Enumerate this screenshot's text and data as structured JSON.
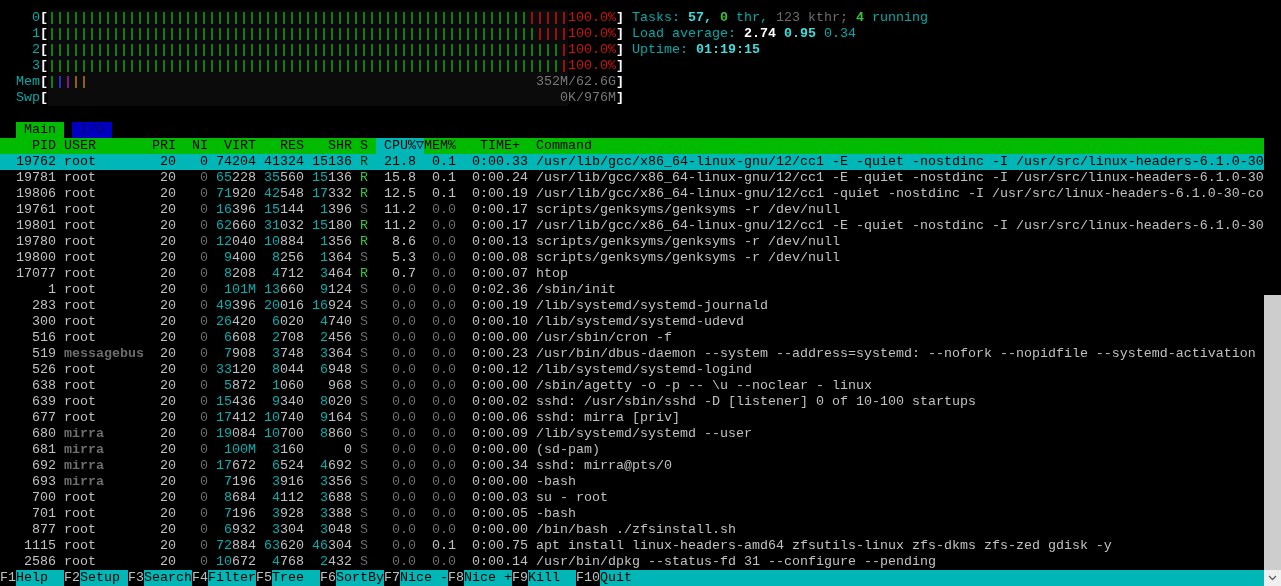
{
  "meters": [
    {
      "kind": "cpu",
      "label": "0",
      "bracket_open": "[",
      "bracket_close": "]",
      "reading": "100.0%",
      "segments": [
        {
          "kind": "normal",
          "level": 0.923
        },
        {
          "kind": "kernel",
          "level": 0.077
        }
      ]
    },
    {
      "kind": "cpu",
      "label": "1",
      "bracket_open": "[",
      "bracket_close": "]",
      "reading": "100.0%",
      "segments": [
        {
          "kind": "normal",
          "level": 0.938
        },
        {
          "kind": "kernel",
          "level": 0.062
        }
      ]
    },
    {
      "kind": "cpu",
      "label": "2",
      "bracket_open": "[",
      "bracket_close": "]",
      "reading": "100.0%",
      "segments": [
        {
          "kind": "normal",
          "level": 0.985
        },
        {
          "kind": "kernel",
          "level": 0.015
        }
      ]
    },
    {
      "kind": "cpu",
      "label": "3",
      "bracket_open": "[",
      "bracket_close": "]",
      "reading": "100.0%",
      "segments": [
        {
          "kind": "normal",
          "level": 0.985
        },
        {
          "kind": "kernel",
          "level": 0.015
        }
      ]
    },
    {
      "kind": "memory",
      "label": "Mem",
      "bracket_open": "[",
      "bracket_close": "]",
      "reading": "352M/62.6G",
      "segments": [
        {
          "kind": "used",
          "level": 0.015
        },
        {
          "kind": "buffers",
          "level": 0.015
        },
        {
          "kind": "shared",
          "level": 0.015
        },
        {
          "kind": "cache",
          "level": 0.03
        }
      ]
    },
    {
      "kind": "swap",
      "label": "Swp",
      "bracket_open": "[",
      "bracket_close": "]",
      "reading": "0K/976M"
    }
  ],
  "summary": [
    {
      "parts": [
        {
          "kind": "label",
          "text": "Tasks:"
        },
        {
          "kind": "value",
          "text": "57,"
        },
        {
          "kind": "count",
          "text": "0"
        },
        {
          "kind": "label",
          "text": "thr,"
        },
        {
          "kind": "muted",
          "text": "123 kthr;"
        },
        {
          "kind": "count",
          "text": "4"
        },
        {
          "kind": "label",
          "text": "running"
        }
      ]
    },
    {
      "parts": [
        {
          "kind": "label",
          "text": "Load average:"
        },
        {
          "kind": "high",
          "text": "2.74"
        },
        {
          "kind": "value",
          "text": "0.95"
        },
        {
          "kind": "label",
          "text": "0.34"
        }
      ]
    },
    {
      "parts": [
        {
          "kind": "label",
          "text": "Uptime:"
        },
        {
          "kind": "value",
          "text": "01:19:15"
        }
      ]
    }
  ],
  "tabs": [
    {
      "label": "Main",
      "selected": true
    },
    {
      "label": "I/O",
      "selected": false
    }
  ],
  "columns": [
    {
      "label": "PID",
      "sorted": false
    },
    {
      "label": "USER",
      "sorted": false
    },
    {
      "label": "PRI",
      "sorted": false
    },
    {
      "label": "NI",
      "sorted": false
    },
    {
      "label": "VIRT",
      "sorted": false
    },
    {
      "label": "RES",
      "sorted": false
    },
    {
      "label": "SHR",
      "sorted": false
    },
    {
      "label": "S",
      "sorted": false
    },
    {
      "label": "CPU%▽",
      "sorted": true
    },
    {
      "label": "MEM%",
      "sorted": false
    },
    {
      "label": "TIME+",
      "sorted": false
    },
    {
      "label": "Command",
      "sorted": false
    }
  ],
  "rows": [
    {
      "selected": true,
      "other_user": false,
      "running": true,
      "pid": "19762",
      "user": "root",
      "pri": "20",
      "ni": "0",
      "virt": "74204",
      "res": "41324",
      "shr": "15136",
      "state": "R",
      "cpu": "21.8",
      "mem": "0.1",
      "time": "0:00.33",
      "command": "/usr/lib/gcc/x86_64-linux-gnu/12/cc1 -E -quiet -nostdinc -I /usr/src/linux-headers-6.1.0-30"
    },
    {
      "selected": false,
      "other_user": false,
      "running": true,
      "pid": "19781",
      "user": "root",
      "pri": "20",
      "ni": "0",
      "virt": "65228",
      "res": "35560",
      "shr": "15136",
      "state": "R",
      "cpu": "15.8",
      "mem": "0.1",
      "time": "0:00.24",
      "command": "/usr/lib/gcc/x86_64-linux-gnu/12/cc1 -E -quiet -nostdinc -I /usr/src/linux-headers-6.1.0-30"
    },
    {
      "selected": false,
      "other_user": false,
      "running": true,
      "pid": "19806",
      "user": "root",
      "pri": "20",
      "ni": "0",
      "virt": "71920",
      "res": "42548",
      "shr": "17332",
      "state": "R",
      "cpu": "12.5",
      "mem": "0.1",
      "time": "0:00.19",
      "command": "/usr/lib/gcc/x86_64-linux-gnu/12/cc1 -quiet -nostdinc -I /usr/src/linux-headers-6.1.0-30-co"
    },
    {
      "selected": false,
      "other_user": false,
      "running": false,
      "pid": "19761",
      "user": "root",
      "pri": "20",
      "ni": "0",
      "virt": "16396",
      "res": "15144",
      "shr": "1396",
      "state": "S",
      "cpu": "11.2",
      "mem": "0.0",
      "time": "0:00.17",
      "command": "scripts/genksyms/genksyms -r /dev/null"
    },
    {
      "selected": false,
      "other_user": false,
      "running": true,
      "pid": "19801",
      "user": "root",
      "pri": "20",
      "ni": "0",
      "virt": "62660",
      "res": "31032",
      "shr": "15180",
      "state": "R",
      "cpu": "11.2",
      "mem": "0.0",
      "time": "0:00.17",
      "command": "/usr/lib/gcc/x86_64-linux-gnu/12/cc1 -E -quiet -nostdinc -I /usr/src/linux-headers-6.1.0-30"
    },
    {
      "selected": false,
      "other_user": false,
      "running": true,
      "pid": "19780",
      "user": "root",
      "pri": "20",
      "ni": "0",
      "virt": "12040",
      "res": "10884",
      "shr": "1356",
      "state": "R",
      "cpu": "8.6",
      "mem": "0.0",
      "time": "0:00.13",
      "command": "scripts/genksyms/genksyms -r /dev/null"
    },
    {
      "selected": false,
      "other_user": false,
      "running": false,
      "pid": "19800",
      "user": "root",
      "pri": "20",
      "ni": "0",
      "virt": "9400",
      "res": "8256",
      "shr": "1364",
      "state": "S",
      "cpu": "5.3",
      "mem": "0.0",
      "time": "0:00.08",
      "command": "scripts/genksyms/genksyms -r /dev/null"
    },
    {
      "selected": false,
      "other_user": false,
      "running": true,
      "pid": "17077",
      "user": "root",
      "pri": "20",
      "ni": "0",
      "virt": "8208",
      "res": "4712",
      "shr": "3464",
      "state": "R",
      "cpu": "0.7",
      "mem": "0.0",
      "time": "0:00.07",
      "command": "htop"
    },
    {
      "selected": false,
      "other_user": false,
      "running": false,
      "pid": "1",
      "user": "root",
      "pri": "20",
      "ni": "0",
      "virt": "101M",
      "res": "13660",
      "shr": "9124",
      "state": "S",
      "cpu": "0.0",
      "mem": "0.0",
      "time": "0:02.36",
      "command": "/sbin/init"
    },
    {
      "selected": false,
      "other_user": false,
      "running": false,
      "pid": "283",
      "user": "root",
      "pri": "20",
      "ni": "0",
      "virt": "49396",
      "res": "20016",
      "shr": "16924",
      "state": "S",
      "cpu": "0.0",
      "mem": "0.0",
      "time": "0:00.19",
      "command": "/lib/systemd/systemd-journald"
    },
    {
      "selected": false,
      "other_user": false,
      "running": false,
      "pid": "300",
      "user": "root",
      "pri": "20",
      "ni": "0",
      "virt": "26420",
      "res": "6020",
      "shr": "4740",
      "state": "S",
      "cpu": "0.0",
      "mem": "0.0",
      "time": "0:00.10",
      "command": "/lib/systemd/systemd-udevd"
    },
    {
      "selected": false,
      "other_user": false,
      "running": false,
      "pid": "516",
      "user": "root",
      "pri": "20",
      "ni": "0",
      "virt": "6608",
      "res": "2708",
      "shr": "2456",
      "state": "S",
      "cpu": "0.0",
      "mem": "0.0",
      "time": "0:00.00",
      "command": "/usr/sbin/cron -f"
    },
    {
      "selected": false,
      "other_user": true,
      "running": false,
      "pid": "519",
      "user": "messagebus",
      "pri": "20",
      "ni": "0",
      "virt": "7908",
      "res": "3748",
      "shr": "3364",
      "state": "S",
      "cpu": "0.0",
      "mem": "0.0",
      "time": "0:00.23",
      "command": "/usr/bin/dbus-daemon --system --address=systemd: --nofork --nopidfile --systemd-activation"
    },
    {
      "selected": false,
      "other_user": false,
      "running": false,
      "pid": "526",
      "user": "root",
      "pri": "20",
      "ni": "0",
      "virt": "33120",
      "res": "8044",
      "shr": "6948",
      "state": "S",
      "cpu": "0.0",
      "mem": "0.0",
      "time": "0:00.12",
      "command": "/lib/systemd/systemd-logind"
    },
    {
      "selected": false,
      "other_user": false,
      "running": false,
      "pid": "638",
      "user": "root",
      "pri": "20",
      "ni": "0",
      "virt": "5872",
      "res": "1060",
      "shr": "968",
      "state": "S",
      "cpu": "0.0",
      "mem": "0.0",
      "time": "0:00.00",
      "command": "/sbin/agetty -o -p -- \\u --noclear - linux"
    },
    {
      "selected": false,
      "other_user": false,
      "running": false,
      "pid": "639",
      "user": "root",
      "pri": "20",
      "ni": "0",
      "virt": "15436",
      "res": "9340",
      "shr": "8020",
      "state": "S",
      "cpu": "0.0",
      "mem": "0.0",
      "time": "0:00.02",
      "command": "sshd: /usr/sbin/sshd -D [listener] 0 of 10-100 startups"
    },
    {
      "selected": false,
      "other_user": false,
      "running": false,
      "pid": "677",
      "user": "root",
      "pri": "20",
      "ni": "0",
      "virt": "17412",
      "res": "10740",
      "shr": "9164",
      "state": "S",
      "cpu": "0.0",
      "mem": "0.0",
      "time": "0:00.06",
      "command": "sshd: mirra [priv]"
    },
    {
      "selected": false,
      "other_user": true,
      "running": false,
      "pid": "680",
      "user": "mirra",
      "pri": "20",
      "ni": "0",
      "virt": "19084",
      "res": "10700",
      "shr": "8860",
      "state": "S",
      "cpu": "0.0",
      "mem": "0.0",
      "time": "0:00.09",
      "command": "/lib/systemd/systemd --user"
    },
    {
      "selected": false,
      "other_user": true,
      "running": false,
      "pid": "681",
      "user": "mirra",
      "pri": "20",
      "ni": "0",
      "virt": "100M",
      "res": "3160",
      "shr": "0",
      "state": "S",
      "cpu": "0.0",
      "mem": "0.0",
      "time": "0:00.00",
      "command": "(sd-pam)"
    },
    {
      "selected": false,
      "other_user": true,
      "running": false,
      "pid": "692",
      "user": "mirra",
      "pri": "20",
      "ni": "0",
      "virt": "17672",
      "res": "6524",
      "shr": "4692",
      "state": "S",
      "cpu": "0.0",
      "mem": "0.0",
      "time": "0:00.34",
      "command": "sshd: mirra@pts/0"
    },
    {
      "selected": false,
      "other_user": true,
      "running": false,
      "pid": "693",
      "user": "mirra",
      "pri": "20",
      "ni": "0",
      "virt": "7196",
      "res": "3916",
      "shr": "3356",
      "state": "S",
      "cpu": "0.0",
      "mem": "0.0",
      "time": "0:00.00",
      "command": "-bash"
    },
    {
      "selected": false,
      "other_user": false,
      "running": false,
      "pid": "700",
      "user": "root",
      "pri": "20",
      "ni": "0",
      "virt": "8684",
      "res": "4112",
      "shr": "3688",
      "state": "S",
      "cpu": "0.0",
      "mem": "0.0",
      "time": "0:00.03",
      "command": "su - root"
    },
    {
      "selected": false,
      "other_user": false,
      "running": false,
      "pid": "701",
      "user": "root",
      "pri": "20",
      "ni": "0",
      "virt": "7196",
      "res": "3928",
      "shr": "3388",
      "state": "S",
      "cpu": "0.0",
      "mem": "0.0",
      "time": "0:00.05",
      "command": "-bash"
    },
    {
      "selected": false,
      "other_user": false,
      "running": false,
      "pid": "877",
      "user": "root",
      "pri": "20",
      "ni": "0",
      "virt": "6932",
      "res": "3304",
      "shr": "3048",
      "state": "S",
      "cpu": "0.0",
      "mem": "0.0",
      "time": "0:00.00",
      "command": "/bin/bash ./zfsinstall.sh"
    },
    {
      "selected": false,
      "other_user": false,
      "running": false,
      "pid": "1115",
      "user": "root",
      "pri": "20",
      "ni": "0",
      "virt": "72884",
      "res": "63620",
      "shr": "46304",
      "state": "S",
      "cpu": "0.0",
      "mem": "0.1",
      "time": "0:00.75",
      "command": "apt install linux-headers-amd64 zfsutils-linux zfs-dkms zfs-zed gdisk -y"
    },
    {
      "selected": false,
      "other_user": false,
      "running": false,
      "pid": "2586",
      "user": "root",
      "pri": "20",
      "ni": "0",
      "virt": "10672",
      "res": "4768",
      "shr": "2432",
      "state": "S",
      "cpu": "0.0",
      "mem": "0.0",
      "time": "0:00.14",
      "command": "/usr/bin/dpkg --status-fd 31 --configure --pending"
    }
  ],
  "function_keys": [
    {
      "key": "F1",
      "label": "Help"
    },
    {
      "key": "F2",
      "label": "Setup"
    },
    {
      "key": "F3",
      "label": "Search"
    },
    {
      "key": "F4",
      "label": "Filter"
    },
    {
      "key": "F5",
      "label": "Tree"
    },
    {
      "key": "F6",
      "label": "SortBy"
    },
    {
      "key": "F7",
      "label": "Nice -"
    },
    {
      "key": "F8",
      "label": "Nice +"
    },
    {
      "key": "F9",
      "label": "Kill"
    },
    {
      "key": "F10",
      "label": "Quit"
    }
  ]
}
